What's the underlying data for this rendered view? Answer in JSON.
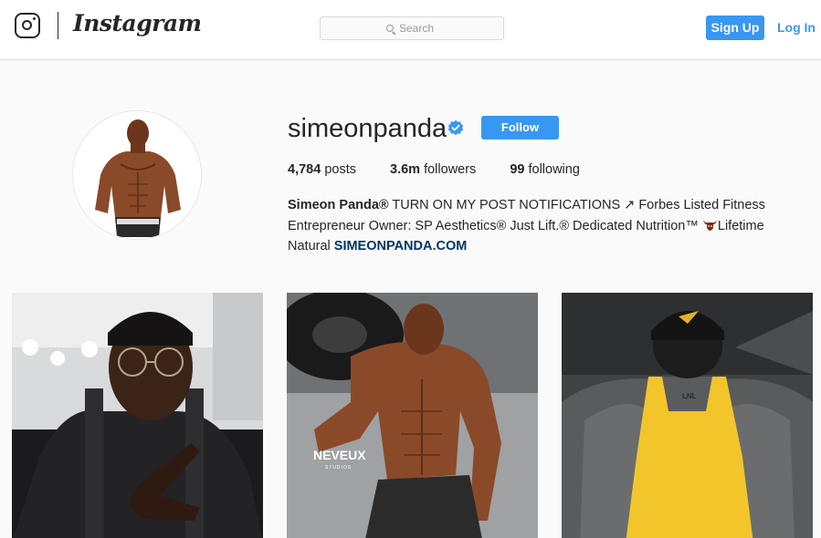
{
  "header": {
    "wordmark": "Instagram",
    "search_placeholder": "Search",
    "signup_label": "Sign Up",
    "login_label": "Log In"
  },
  "profile": {
    "username": "simeonpanda",
    "follow_label": "Follow",
    "stats": {
      "posts_count": "4,784",
      "posts_label": "posts",
      "followers_count": "3.6m",
      "followers_label": "followers",
      "following_count": "99",
      "following_label": "following"
    },
    "bio": {
      "name": "Simeon Panda®",
      "line1_rest": " TURN ON MY POST NOTIFICATIONS ↗ Forbes Listed Fitness",
      "line2": "Entrepreneur Owner: SP Aesthetics® Just Lift.®  Dedicated Nutrition™ ",
      "line2_tail": "Lifetime",
      "line3": "Natural ",
      "link": "SIMEONPANDA.COM"
    }
  },
  "posts": [
    {
      "alt": "selfie"
    },
    {
      "alt": "gym",
      "watermark": "NEVEUX",
      "watermark_sub": "STUDIOS"
    },
    {
      "alt": "back",
      "shirt_text": "LNL"
    }
  ],
  "colors": {
    "accent": "#3897f0",
    "link": "#003569",
    "text": "#262626",
    "background": "#fafafa"
  },
  "icons": [
    "instagram-logo-icon",
    "search-icon",
    "verified-badge-icon",
    "bull-emoji-icon"
  ]
}
